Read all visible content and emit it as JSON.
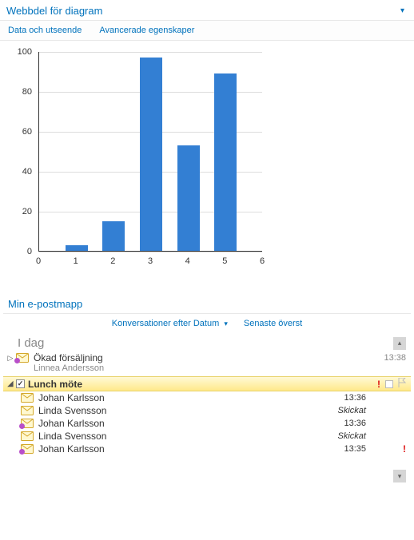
{
  "chart_wp": {
    "title": "Webbdel för diagram",
    "toolbar": {
      "data": "Data och utseende",
      "advanced": "Avancerade egenskaper"
    }
  },
  "chart_data": {
    "type": "bar",
    "categories": [
      1,
      2,
      3,
      4,
      5
    ],
    "values": [
      3,
      15,
      97,
      53,
      89
    ],
    "title": "",
    "xlabel": "",
    "ylabel": "",
    "xlim": [
      0,
      6
    ],
    "ylim": [
      0,
      100
    ],
    "xticks": [
      0,
      1,
      2,
      3,
      4,
      5,
      6
    ],
    "yticks": [
      0,
      20,
      40,
      60,
      80,
      100
    ]
  },
  "mail_wp": {
    "title": "Min e-postmapp",
    "sort_by": "Konversationer efter Datum",
    "order": "Senaste överst",
    "date_header": "I dag",
    "threads": [
      {
        "subject": "Ökad försäljning",
        "sender": "Linnea Andersson",
        "time": "13:38",
        "expanded": false,
        "selected": false,
        "icon": "envelope-reply"
      },
      {
        "subject": "Lunch möte",
        "expanded": true,
        "selected": true,
        "important": true,
        "checked": true,
        "children": [
          {
            "sender": "Johan Karlsson",
            "time": "13:36",
            "icon": "envelope"
          },
          {
            "sender": "Linda Svensson",
            "status": "Skickat",
            "icon": "envelope"
          },
          {
            "sender": "Johan Karlsson",
            "time": "13:36",
            "icon": "envelope-reply"
          },
          {
            "sender": "Linda Svensson",
            "status": "Skickat",
            "icon": "envelope"
          },
          {
            "sender": "Johan Karlsson",
            "time": "13:35",
            "icon": "envelope-reply",
            "important": true
          }
        ]
      }
    ]
  }
}
